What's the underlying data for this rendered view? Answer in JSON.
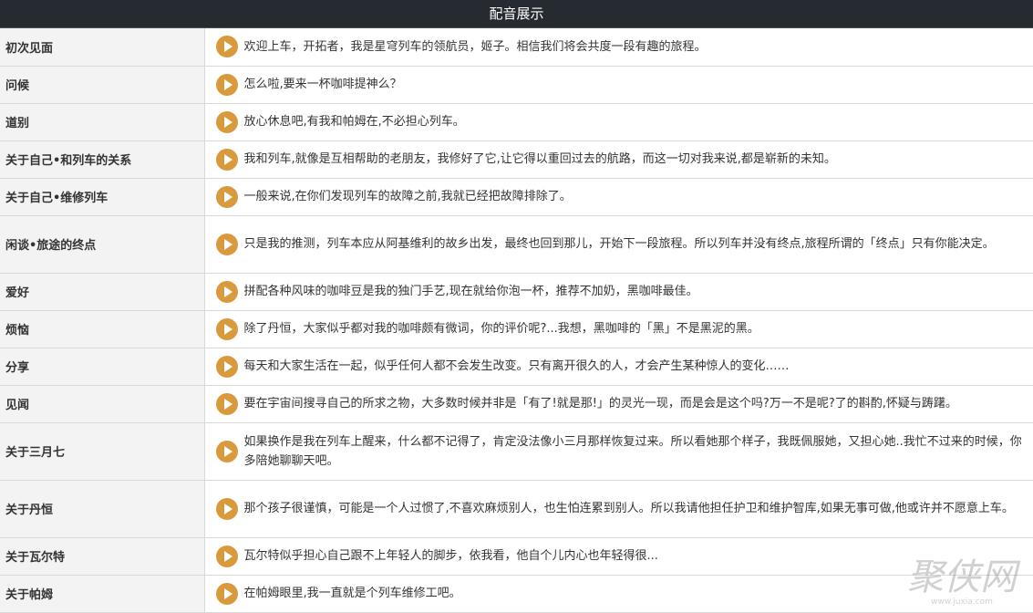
{
  "header": {
    "title": "配音展示"
  },
  "colors": {
    "header_bg": "#262a31",
    "play_button": "#d99a3e",
    "title_cell_bg": "#f3f3f3"
  },
  "rows": [
    {
      "title": "初次见面",
      "text": "欢迎上车，开拓者，我是星穹列车的领航员，姬子。相信我们将会共度一段有趣的旅程。"
    },
    {
      "title": "问候",
      "text": "怎么啦,要来一杯咖啡提神么？"
    },
    {
      "title": "道别",
      "text": "放心休息吧,有我和帕姆在,不必担心列车。"
    },
    {
      "title": "关于自己•和列车的关系",
      "text": "我和列车,就像是互相帮助的老朋友，我修好了它,让它得以重回过去的航路，而这一切对我来说,都是崭新的未知。"
    },
    {
      "title": "关于自己•维修列车",
      "text": "一般来说,在你们发现列车的故障之前,我就已经把故障排除了。"
    },
    {
      "title": "闲谈•旅途的终点",
      "text": "只是我的推测，列车本应从阿基维利的故乡出发，最终也回到那儿，开始下一段旅程。所以列车并没有终点,旅程所谓的「终点」只有你能决定。"
    },
    {
      "title": "爱好",
      "text": "拼配各种风味的咖啡豆是我的独门手艺,现在就给你泡一杯，推荐不加奶，黑咖啡最佳。"
    },
    {
      "title": "烦恼",
      "text": "除了丹恒，大家似乎都对我的咖啡颇有微词，你的评价呢?...我想，黑咖啡的「黑」不是黑泥的黑。"
    },
    {
      "title": "分享",
      "text": "每天和大家生活在一起，似乎任何人都不会发生改变。只有离开很久的人，才会产生某种惊人的变化……"
    },
    {
      "title": "见闻",
      "text": "要在宇宙间搜寻自己的所求之物，大多数时候并非是「有了!就是那!」的灵光一现，而是会是这个吗?万一不是呢?了的斟酌,怀疑与踌躇。"
    },
    {
      "title": "关于三月七",
      "text": "如果换作是我在列车上醒来，什么都不记得了，肯定没法像小三月那样恢复过来。所以看她那个样子，我既佩服她，又担心她..我忙不过来的时候，你多陪她聊聊天吧。"
    },
    {
      "title": "关于丹恒",
      "text": "那个孩子很谨慎，可能是一个人过惯了,不喜欢麻烦别人，也生怕连累到别人。所以我请他担任护卫和维护智库,如果无事可做,他或许并不愿意上车。"
    },
    {
      "title": "关于瓦尔特",
      "text": "瓦尔特似乎担心自己跟不上年轻人的脚步，依我看，他自个儿内心也年轻得很..."
    },
    {
      "title": "关于帕姆",
      "text": "在帕姆眼里,我一直就是个列车维修工吧。"
    }
  ],
  "watermark": {
    "main": "聚侠网",
    "sub": "www.juxia.com"
  }
}
